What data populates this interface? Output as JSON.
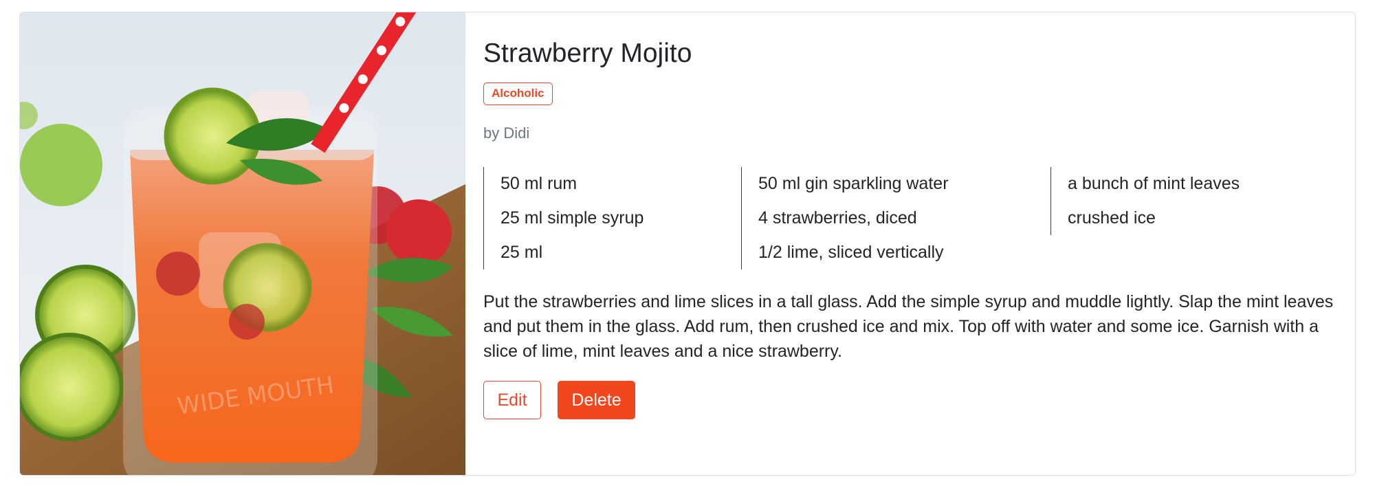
{
  "recipe": {
    "title": "Strawberry Mojito",
    "category_badge": "Alcoholic",
    "author": "by Didi",
    "ingredients": {
      "column1": [
        "50 ml rum",
        "25 ml simple syrup",
        "25 ml"
      ],
      "column2": [
        "50 ml gin sparkling water",
        "4 strawberries, diced",
        "1/2 lime, sliced vertically"
      ],
      "column3": [
        "a bunch of mint leaves",
        "crushed ice"
      ]
    },
    "instructions": "Put the strawberries and lime slices in a tall glass. Add the simple syrup and muddle lightly. Slap the mint leaves and put them in the glass. Add rum, then crushed ice and mix. Top off with water and some ice. Garnish with a slice of lime, mint leaves and a nice strawberry."
  },
  "actions": {
    "edit_label": "Edit",
    "delete_label": "Delete"
  },
  "colors": {
    "accent": "#e8492c",
    "delete_bg": "#f2461e",
    "muted_text": "#6c757d",
    "border": "#dee2e6"
  }
}
